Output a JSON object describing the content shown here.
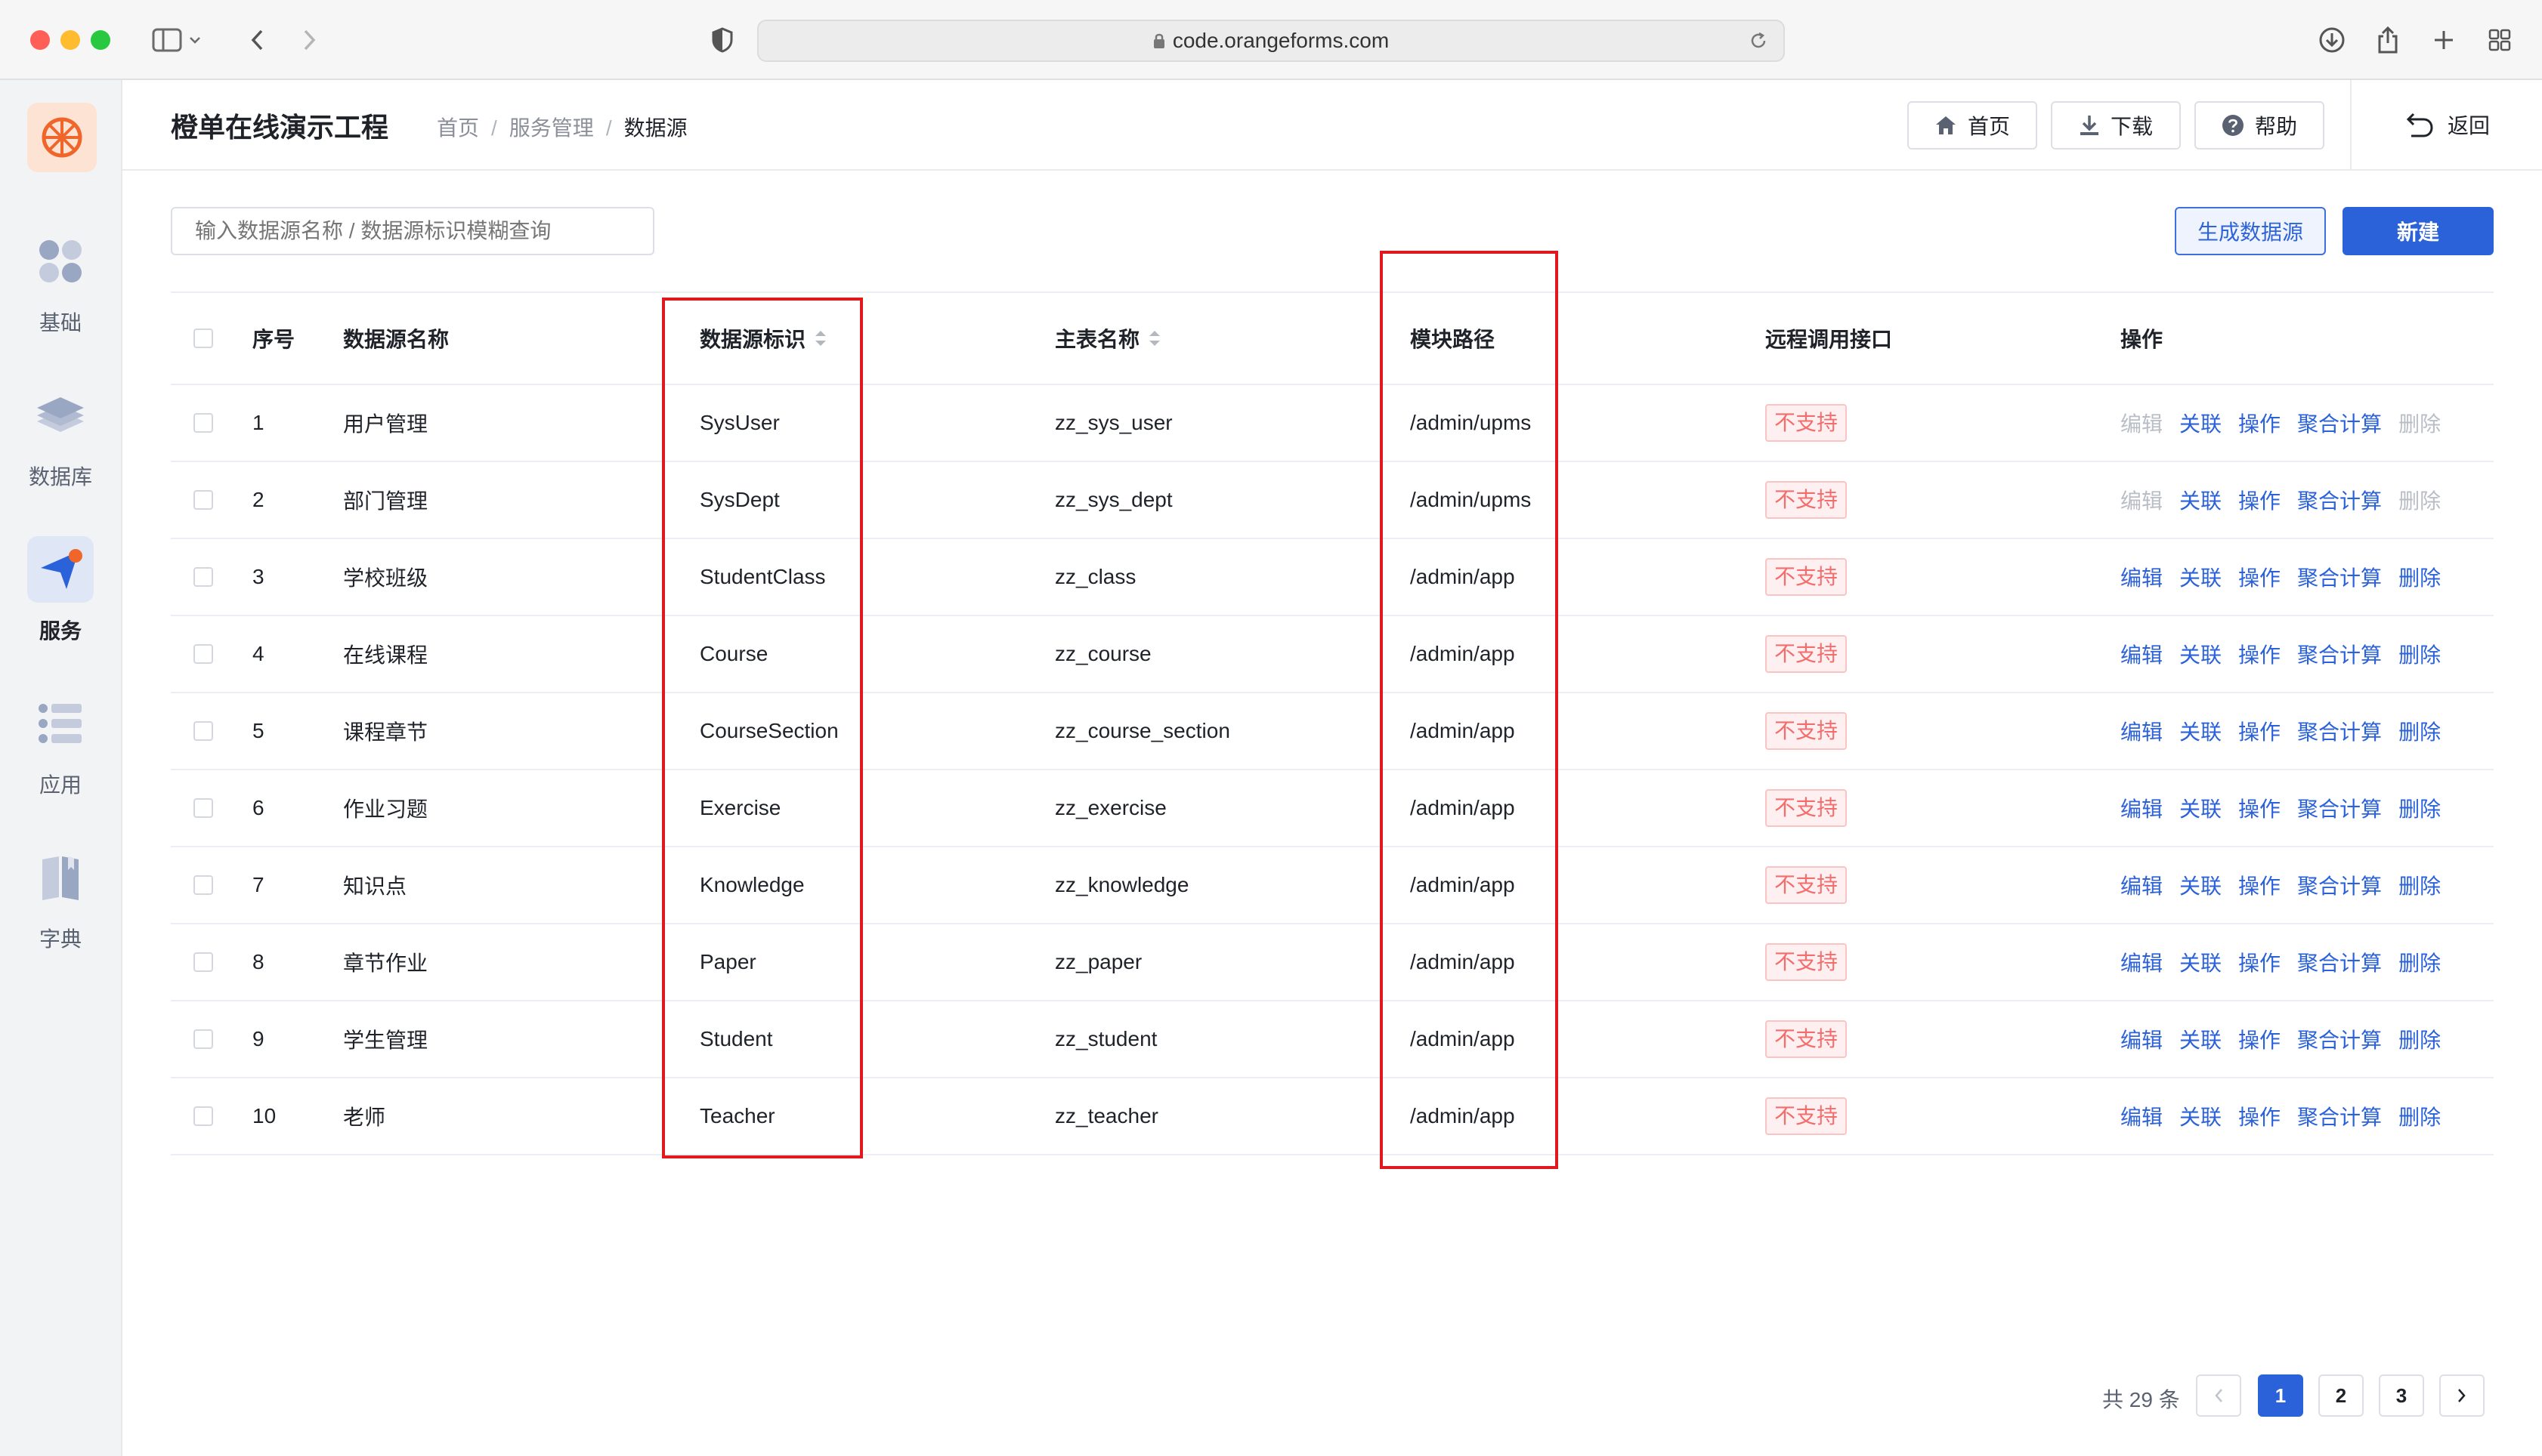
{
  "browser": {
    "url": "code.orangeforms.com"
  },
  "rail": {
    "items": [
      {
        "label": "基础",
        "icon": "grid-apps-icon"
      },
      {
        "label": "数据库",
        "icon": "layers-database-icon"
      },
      {
        "label": "服务",
        "icon": "navigation-send-icon"
      },
      {
        "label": "应用",
        "icon": "list-app-icon"
      },
      {
        "label": "字典",
        "icon": "book-dictionary-icon"
      }
    ],
    "active_index": 2
  },
  "header": {
    "title": "橙单在线演示工程",
    "breadcrumb": [
      "首页",
      "服务管理",
      "数据源"
    ],
    "home_label": "首页",
    "download_label": "下载",
    "help_label": "帮助",
    "back_label": "返回"
  },
  "toolbar": {
    "search_placeholder": "输入数据源名称 / 数据源标识模糊查询",
    "generate_label": "生成数据源",
    "new_label": "新建"
  },
  "table": {
    "columns": [
      "序号",
      "数据源名称",
      "数据源标识",
      "主表名称",
      "模块路径",
      "远程调用接口",
      "操作"
    ],
    "rows": [
      {
        "index": "1",
        "name": "用户管理",
        "identifier": "SysUser",
        "main_table": "zz_sys_user",
        "module_path": "/admin/upms",
        "remote": "不支持",
        "edit_disabled": true
      },
      {
        "index": "2",
        "name": "部门管理",
        "identifier": "SysDept",
        "main_table": "zz_sys_dept",
        "module_path": "/admin/upms",
        "remote": "不支持",
        "edit_disabled": true
      },
      {
        "index": "3",
        "name": "学校班级",
        "identifier": "StudentClass",
        "main_table": "zz_class",
        "module_path": "/admin/app",
        "remote": "不支持",
        "edit_disabled": false
      },
      {
        "index": "4",
        "name": "在线课程",
        "identifier": "Course",
        "main_table": "zz_course",
        "module_path": "/admin/app",
        "remote": "不支持",
        "edit_disabled": false
      },
      {
        "index": "5",
        "name": "课程章节",
        "identifier": "CourseSection",
        "main_table": "zz_course_section",
        "module_path": "/admin/app",
        "remote": "不支持",
        "edit_disabled": false
      },
      {
        "index": "6",
        "name": "作业习题",
        "identifier": "Exercise",
        "main_table": "zz_exercise",
        "module_path": "/admin/app",
        "remote": "不支持",
        "edit_disabled": false
      },
      {
        "index": "7",
        "name": "知识点",
        "identifier": "Knowledge",
        "main_table": "zz_knowledge",
        "module_path": "/admin/app",
        "remote": "不支持",
        "edit_disabled": false
      },
      {
        "index": "8",
        "name": "章节作业",
        "identifier": "Paper",
        "main_table": "zz_paper",
        "module_path": "/admin/app",
        "remote": "不支持",
        "edit_disabled": false
      },
      {
        "index": "9",
        "name": "学生管理",
        "identifier": "Student",
        "main_table": "zz_student",
        "module_path": "/admin/app",
        "remote": "不支持",
        "edit_disabled": false
      },
      {
        "index": "10",
        "name": "老师",
        "identifier": "Teacher",
        "main_table": "zz_teacher",
        "module_path": "/admin/app",
        "remote": "不支持",
        "edit_disabled": false
      }
    ],
    "actions": [
      "编辑",
      "关联",
      "操作",
      "聚合计算",
      "删除"
    ]
  },
  "pagination": {
    "total_label": "共 29 条",
    "pages": [
      "1",
      "2",
      "3"
    ],
    "current": "1"
  },
  "colors": {
    "primary": "#2b62d9",
    "danger": "#f56c6c",
    "highlight": "#e0191f",
    "brand_orange": "#f0652a"
  }
}
